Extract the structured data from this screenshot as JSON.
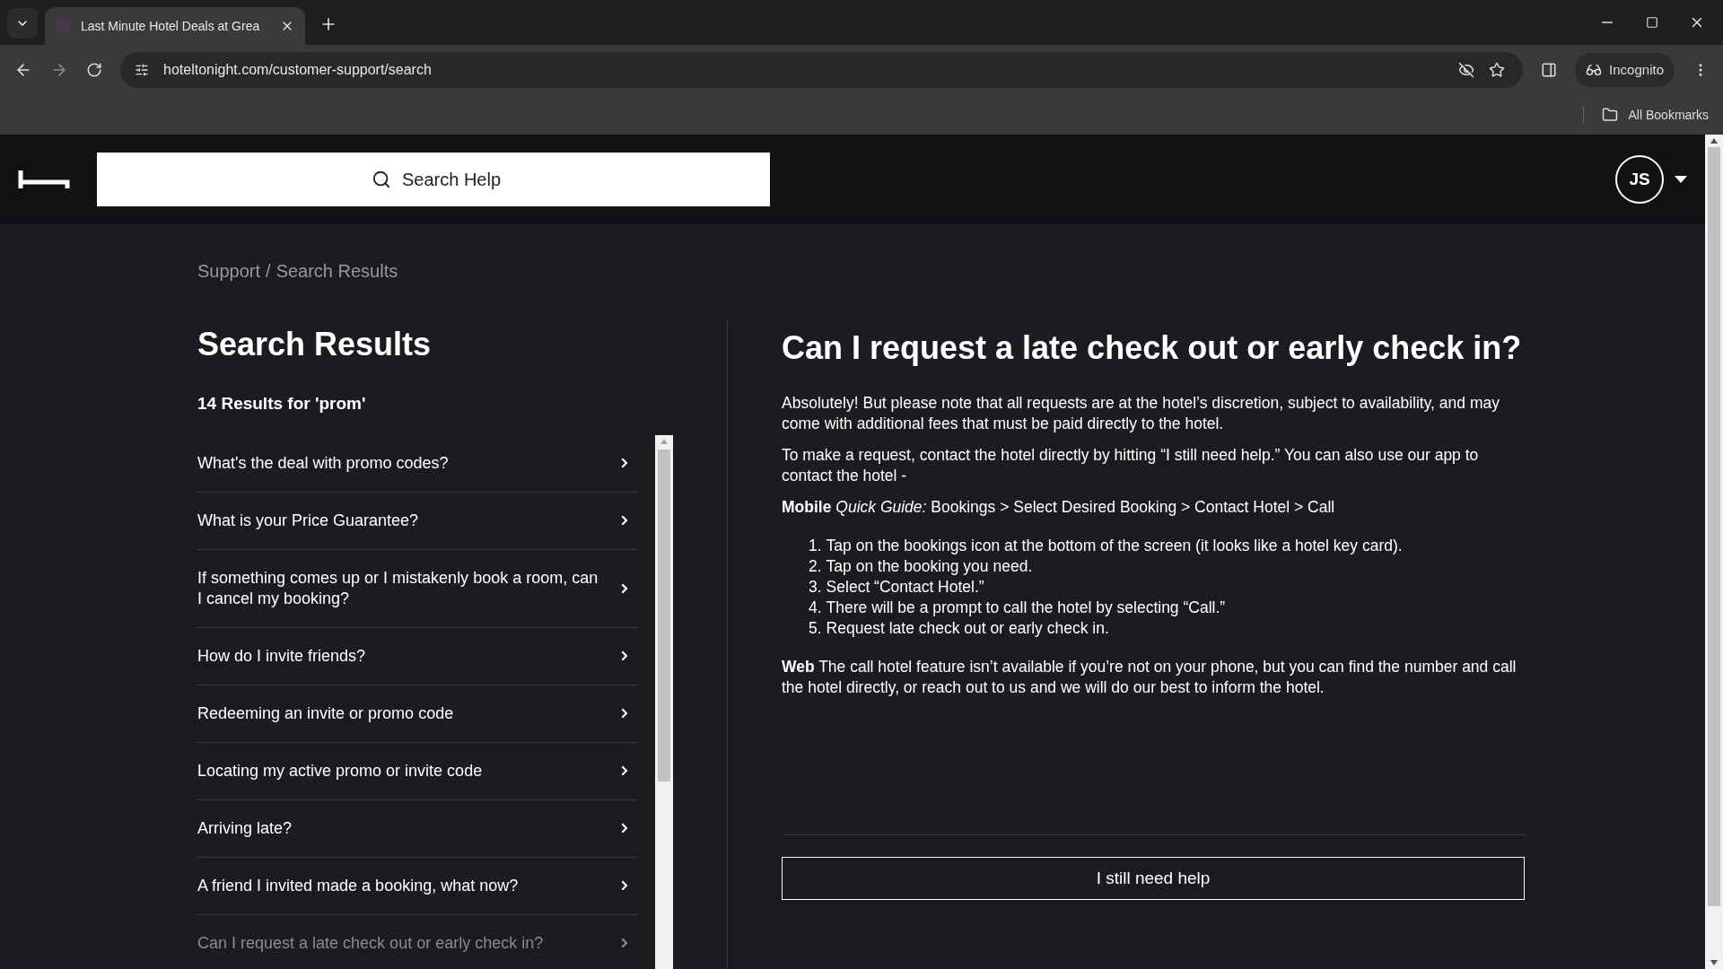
{
  "browser": {
    "tab_title": "Last Minute Hotel Deals at Grea",
    "url": "hoteltonight.com/customer-support/search",
    "profile_label": "Incognito",
    "bookmarks_label": "All Bookmarks"
  },
  "header": {
    "search_placeholder": "Search Help",
    "avatar_initials": "JS"
  },
  "breadcrumb": {
    "items": [
      "Support",
      "Search Results"
    ],
    "separator": "/"
  },
  "results": {
    "title": "Search Results",
    "count_label": "14 Results for 'prom'",
    "items": [
      {
        "label": "What's the deal with promo codes?",
        "selected": false
      },
      {
        "label": "What is your Price Guarantee?",
        "selected": false
      },
      {
        "label": "If something comes up or I mistakenly book a room, can I cancel my booking?",
        "selected": false
      },
      {
        "label": "How do I invite friends?",
        "selected": false
      },
      {
        "label": "Redeeming an invite or promo code",
        "selected": false
      },
      {
        "label": "Locating my active promo or invite code",
        "selected": false
      },
      {
        "label": "Arriving late?",
        "selected": false
      },
      {
        "label": "A friend I invited made a booking, what now?",
        "selected": false
      },
      {
        "label": "Can I request a late check out or early check in?",
        "selected": true
      }
    ]
  },
  "article": {
    "title": "Can I request a late check out or early check in?",
    "blocks": [
      {
        "kind": "paragraph",
        "text": "Absolutely! But please note that all requests are at the hotel’s discretion, subject to availability, and may come with additional fees that must be paid directly to the hotel."
      },
      {
        "kind": "paragraph",
        "text": "To make a request, contact the hotel directly by hitting “I still need help.” You can also use our app to contact the hotel -"
      },
      {
        "kind": "paragraph",
        "text": "**Mobile** *Quick Guide:* Bookings > Select Desired Booking > Contact Hotel > Call"
      },
      {
        "kind": "list",
        "items": [
          {
            "number": "1.",
            "text": "Tap on the bookings icon at the bottom of the screen (it looks like a hotel key card)."
          },
          {
            "number": "2.",
            "text": "Tap on the booking you need."
          },
          {
            "number": "3.",
            "text": "Select “Contact Hotel.”"
          },
          {
            "number": "4.",
            "text": "There will be a prompt to call the hotel by selecting “Call.”"
          },
          {
            "number": "5.",
            "text": "Request late check out or early check in."
          }
        ]
      },
      {
        "kind": "paragraph",
        "text": "**Web** The call hotel feature isn’t available if you’re not on your phone, but you can find the number and call the hotel directly, or reach out to us and we will do our best to inform the hotel."
      }
    ],
    "help_button": "I still need help"
  }
}
